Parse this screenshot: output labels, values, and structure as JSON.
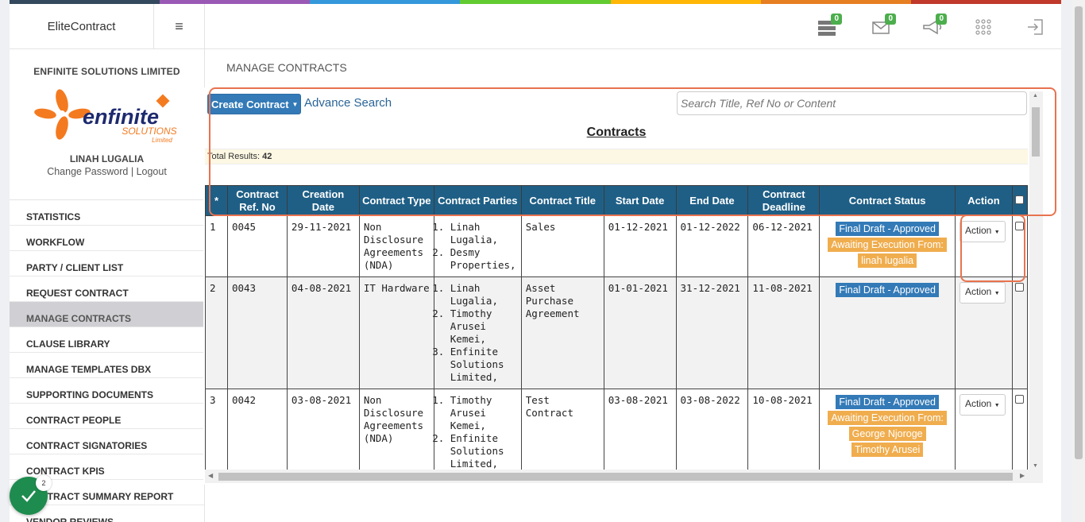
{
  "stripe_colors": [
    "#34495e",
    "#9b59b6",
    "#3498db",
    "#62cb31",
    "#ffb606",
    "#e67e22",
    "#c0392b"
  ],
  "brand": {
    "name": "EliteContract",
    "toggle": "≡"
  },
  "org": {
    "name": "ENFINITE SOLUTIONS LIMITED",
    "logo_word": "enfinite",
    "logo_sub": "SOLUTIONS",
    "logo_sub2": "Limited",
    "user": "LINAH LUGALIA",
    "change_password": "Change Password",
    "separator": "|",
    "logout": "Logout"
  },
  "menu": [
    "STATISTICS",
    "WORKFLOW",
    "PARTY / CLIENT LIST",
    "REQUEST CONTRACT",
    "MANAGE CONTRACTS",
    "CLAUSE LIBRARY",
    "MANAGE TEMPLATES DBX",
    "SUPPORTING DOCUMENTS",
    "CONTRACT PEOPLE",
    "CONTRACT SIGNATORIES",
    "CONTRACT KPIS",
    "CONTRACT SUMMARY REPORT",
    "VENDOR REVIEWS"
  ],
  "header": {
    "badges": [
      "0",
      "0",
      "0"
    ]
  },
  "page_title": "MANAGE CONTRACTS",
  "toolbar": {
    "create_label": "Create Contract",
    "advance_search": "Advance Search",
    "search_placeholder": "Search Title, Ref No or Content"
  },
  "list_title": "Contracts",
  "total": {
    "label": "Total Results:",
    "value": "42"
  },
  "columns": [
    "*",
    "Contract Ref. No",
    "Creation Date",
    "Contract Type",
    "Contract Parties",
    "Contract Title",
    "Start Date",
    "End Date",
    "Contract Deadline",
    "Contract Status",
    "Action"
  ],
  "rows": [
    {
      "num": "1",
      "ref": "0045",
      "created": "29-11-2021",
      "type": "Non Disclosure Agreements (NDA)",
      "parties": [
        "Linah Lugalia,",
        "Desmy Properties,"
      ],
      "title": "Sales",
      "start": "01-12-2021",
      "end": "01-12-2022",
      "deadline": "06-12-2021",
      "status": "Final Draft - Approved",
      "awaiting": "Awaiting Execution From:",
      "awaiting_names": [
        "linah lugalia"
      ],
      "action": "Action"
    },
    {
      "num": "2",
      "ref": "0043",
      "created": "04-08-2021",
      "type": "IT Hardware",
      "parties": [
        "Linah Lugalia,",
        "Timothy Arusei Kemei,",
        "Enfinite Solutions Limited,"
      ],
      "title": "Asset Purchase Agreement",
      "start": "01-01-2021",
      "end": "31-12-2021",
      "deadline": "11-08-2021",
      "status": "Final Draft - Approved",
      "awaiting": "",
      "awaiting_names": [],
      "action": "Action"
    },
    {
      "num": "3",
      "ref": "0042",
      "created": "03-08-2021",
      "type": "Non Disclosure Agreements (NDA)",
      "parties": [
        "Timothy Arusei Kemei,",
        "Enfinite Solutions Limited,"
      ],
      "title": "Test Contract",
      "start": "03-08-2021",
      "end": "03-08-2022",
      "deadline": "10-08-2021",
      "status": "Final Draft - Approved",
      "awaiting": "Awaiting Execution From:",
      "awaiting_names": [
        "George Njoroge",
        "Timothy Arusei"
      ],
      "action": "Action"
    }
  ],
  "fab_badge": "2"
}
